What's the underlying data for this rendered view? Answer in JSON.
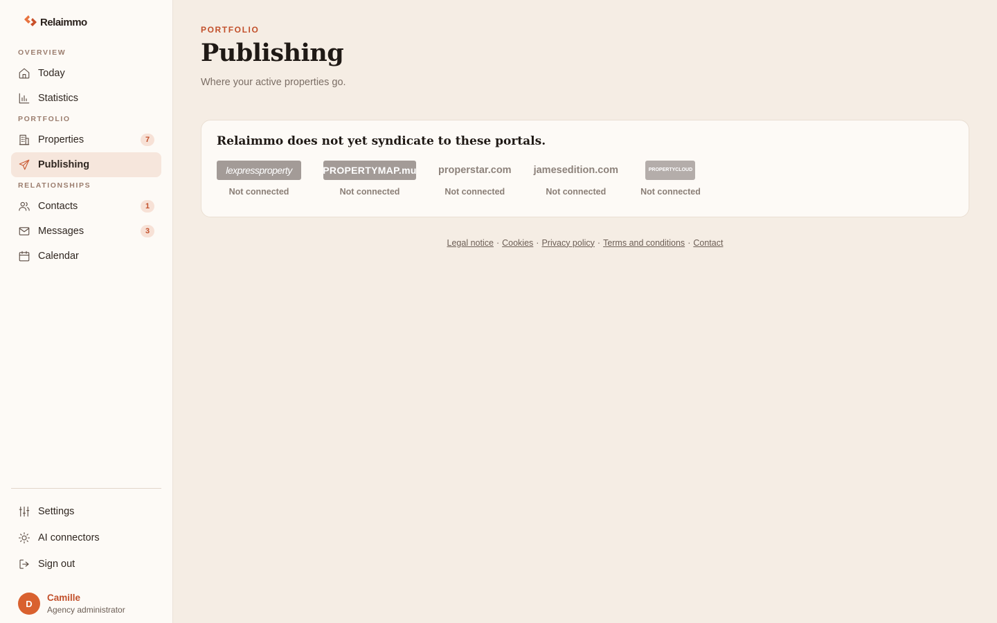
{
  "brand": {
    "name": "Relaimmo"
  },
  "sidebar": {
    "sections": [
      {
        "label": "OVERVIEW"
      },
      {
        "label": "PORTFOLIO"
      },
      {
        "label": "RELATIONSHIPS"
      }
    ],
    "items": [
      {
        "label": "Today",
        "icon": "home-icon"
      },
      {
        "label": "Statistics",
        "icon": "bar-chart-icon"
      },
      {
        "label": "Properties",
        "icon": "building-icon",
        "badge": "7"
      },
      {
        "label": "Publishing",
        "icon": "send-icon",
        "active": true
      },
      {
        "label": "Contacts",
        "icon": "users-icon",
        "badge": "1"
      },
      {
        "label": "Messages",
        "icon": "mail-icon",
        "badge": "3"
      },
      {
        "label": "Calendar",
        "icon": "calendar-icon"
      }
    ],
    "bottom_items": [
      {
        "label": "Settings",
        "icon": "sliders-icon"
      },
      {
        "label": "AI connectors",
        "icon": "sun-icon"
      },
      {
        "label": "Sign out",
        "icon": "sign-out-icon"
      }
    ],
    "user": {
      "initial": "D",
      "name": "Camille",
      "role": "Agency administrator"
    }
  },
  "main": {
    "eyebrow": "PORTFOLIO",
    "title": "Publishing",
    "subtitle": "Where your active properties go.",
    "card": {
      "title": "Relaimmo does not yet syndicate to these portals.",
      "portals": [
        {
          "name": "lexpressproperty",
          "status": "Not connected"
        },
        {
          "name": "PROPERTYMAP.mu",
          "status": "Not connected"
        },
        {
          "name": "properstar.com",
          "status": "Not connected"
        },
        {
          "name": "jamesedition.com",
          "status": "Not connected"
        },
        {
          "name": "PROPERTYCLOUD",
          "status": "Not connected"
        }
      ]
    },
    "footer": {
      "links": [
        "Legal notice",
        "Cookies",
        "Privacy policy",
        "Terms and conditions",
        "Contact"
      ],
      "separator": "·"
    }
  },
  "colors": {
    "accent": "#c2502b",
    "background": "#f5ede4",
    "sidebar_bg": "#fdfaf6",
    "active_bg": "#f6e6dc"
  }
}
